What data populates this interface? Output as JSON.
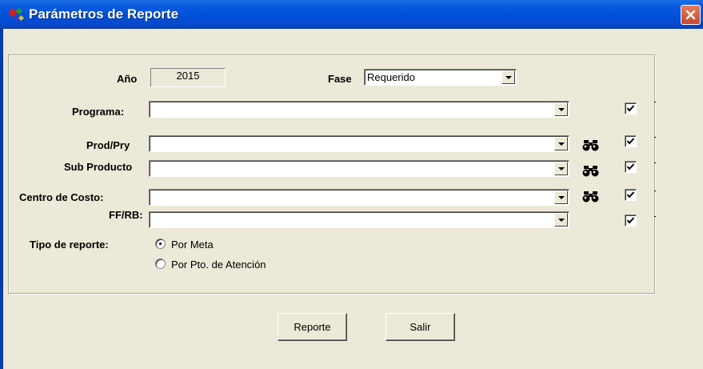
{
  "window": {
    "title": "Parámetros de Reporte"
  },
  "form": {
    "anio": {
      "label": "Año",
      "value": "2015"
    },
    "fase": {
      "label": "Fase",
      "value": "Requerido"
    },
    "programa": {
      "label": "Programa:",
      "value": "",
      "checked": true
    },
    "prodpry": {
      "label": "Prod/Pry",
      "value": "",
      "checked": true
    },
    "subproducto": {
      "label": "Sub Producto",
      "value": "",
      "checked": true
    },
    "centrocosto": {
      "label": "Centro de Costo:",
      "value": "",
      "checked": true
    },
    "ffrb": {
      "label": "FF/RB:",
      "value": "",
      "checked": true
    },
    "tipo_reporte": {
      "label": "Tipo de reporte:",
      "options": [
        {
          "label": "Por Meta",
          "selected": true
        },
        {
          "label": "Por Pto. de Atención",
          "selected": false
        }
      ]
    }
  },
  "buttons": {
    "reporte": "Reporte",
    "salir": "Salir"
  },
  "icons": {
    "app": "report-params-icon",
    "search": "binoculars-icon",
    "close": "close-icon"
  },
  "colors": {
    "titlebar": "#0050d8",
    "window_bg": "#ece9d8",
    "close": "#c9472a"
  }
}
